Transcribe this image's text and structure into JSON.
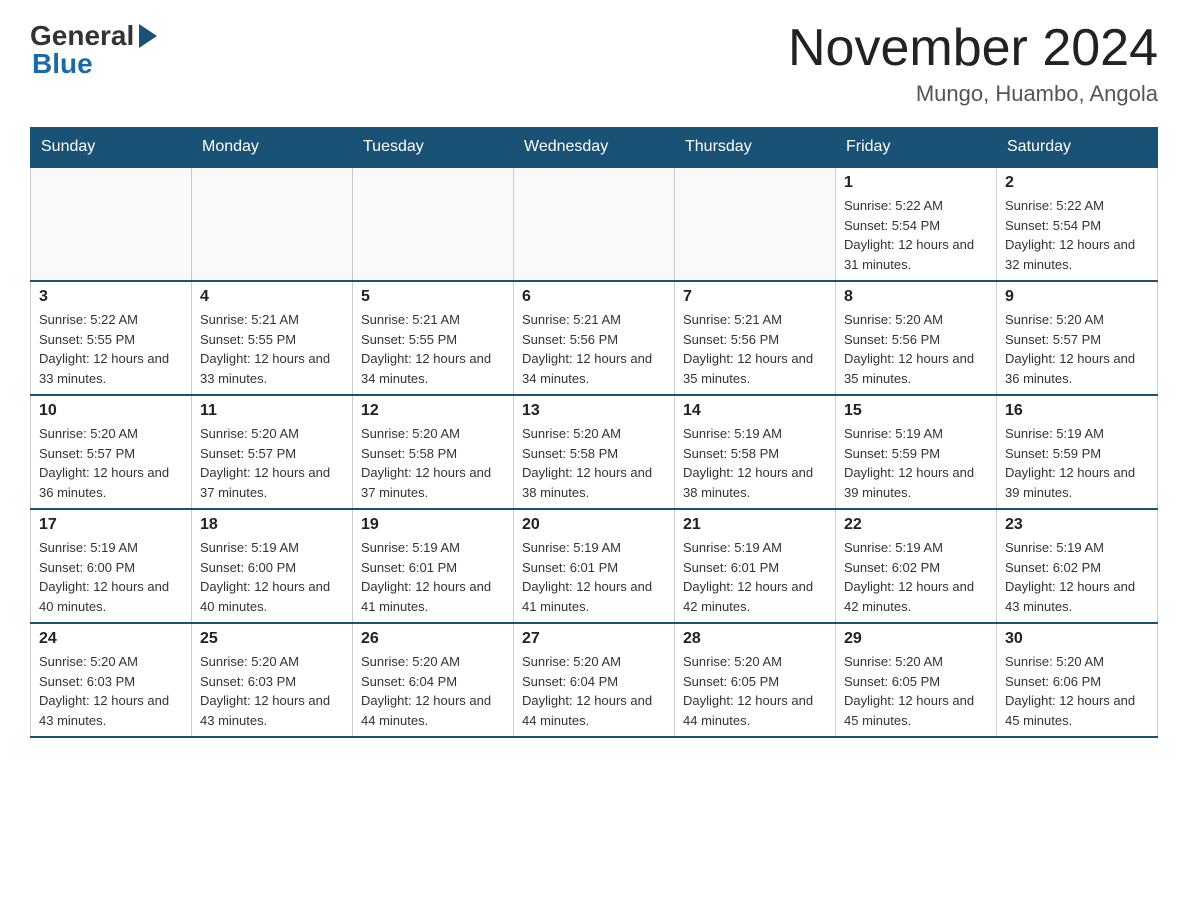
{
  "header": {
    "logo_general": "General",
    "logo_blue": "Blue",
    "month_title": "November 2024",
    "location": "Mungo, Huambo, Angola"
  },
  "days_of_week": [
    "Sunday",
    "Monday",
    "Tuesday",
    "Wednesday",
    "Thursday",
    "Friday",
    "Saturday"
  ],
  "weeks": [
    [
      {
        "day": "",
        "sunrise": "",
        "sunset": "",
        "daylight": ""
      },
      {
        "day": "",
        "sunrise": "",
        "sunset": "",
        "daylight": ""
      },
      {
        "day": "",
        "sunrise": "",
        "sunset": "",
        "daylight": ""
      },
      {
        "day": "",
        "sunrise": "",
        "sunset": "",
        "daylight": ""
      },
      {
        "day": "",
        "sunrise": "",
        "sunset": "",
        "daylight": ""
      },
      {
        "day": "1",
        "sunrise": "Sunrise: 5:22 AM",
        "sunset": "Sunset: 5:54 PM",
        "daylight": "Daylight: 12 hours and 31 minutes."
      },
      {
        "day": "2",
        "sunrise": "Sunrise: 5:22 AM",
        "sunset": "Sunset: 5:54 PM",
        "daylight": "Daylight: 12 hours and 32 minutes."
      }
    ],
    [
      {
        "day": "3",
        "sunrise": "Sunrise: 5:22 AM",
        "sunset": "Sunset: 5:55 PM",
        "daylight": "Daylight: 12 hours and 33 minutes."
      },
      {
        "day": "4",
        "sunrise": "Sunrise: 5:21 AM",
        "sunset": "Sunset: 5:55 PM",
        "daylight": "Daylight: 12 hours and 33 minutes."
      },
      {
        "day": "5",
        "sunrise": "Sunrise: 5:21 AM",
        "sunset": "Sunset: 5:55 PM",
        "daylight": "Daylight: 12 hours and 34 minutes."
      },
      {
        "day": "6",
        "sunrise": "Sunrise: 5:21 AM",
        "sunset": "Sunset: 5:56 PM",
        "daylight": "Daylight: 12 hours and 34 minutes."
      },
      {
        "day": "7",
        "sunrise": "Sunrise: 5:21 AM",
        "sunset": "Sunset: 5:56 PM",
        "daylight": "Daylight: 12 hours and 35 minutes."
      },
      {
        "day": "8",
        "sunrise": "Sunrise: 5:20 AM",
        "sunset": "Sunset: 5:56 PM",
        "daylight": "Daylight: 12 hours and 35 minutes."
      },
      {
        "day": "9",
        "sunrise": "Sunrise: 5:20 AM",
        "sunset": "Sunset: 5:57 PM",
        "daylight": "Daylight: 12 hours and 36 minutes."
      }
    ],
    [
      {
        "day": "10",
        "sunrise": "Sunrise: 5:20 AM",
        "sunset": "Sunset: 5:57 PM",
        "daylight": "Daylight: 12 hours and 36 minutes."
      },
      {
        "day": "11",
        "sunrise": "Sunrise: 5:20 AM",
        "sunset": "Sunset: 5:57 PM",
        "daylight": "Daylight: 12 hours and 37 minutes."
      },
      {
        "day": "12",
        "sunrise": "Sunrise: 5:20 AM",
        "sunset": "Sunset: 5:58 PM",
        "daylight": "Daylight: 12 hours and 37 minutes."
      },
      {
        "day": "13",
        "sunrise": "Sunrise: 5:20 AM",
        "sunset": "Sunset: 5:58 PM",
        "daylight": "Daylight: 12 hours and 38 minutes."
      },
      {
        "day": "14",
        "sunrise": "Sunrise: 5:19 AM",
        "sunset": "Sunset: 5:58 PM",
        "daylight": "Daylight: 12 hours and 38 minutes."
      },
      {
        "day": "15",
        "sunrise": "Sunrise: 5:19 AM",
        "sunset": "Sunset: 5:59 PM",
        "daylight": "Daylight: 12 hours and 39 minutes."
      },
      {
        "day": "16",
        "sunrise": "Sunrise: 5:19 AM",
        "sunset": "Sunset: 5:59 PM",
        "daylight": "Daylight: 12 hours and 39 minutes."
      }
    ],
    [
      {
        "day": "17",
        "sunrise": "Sunrise: 5:19 AM",
        "sunset": "Sunset: 6:00 PM",
        "daylight": "Daylight: 12 hours and 40 minutes."
      },
      {
        "day": "18",
        "sunrise": "Sunrise: 5:19 AM",
        "sunset": "Sunset: 6:00 PM",
        "daylight": "Daylight: 12 hours and 40 minutes."
      },
      {
        "day": "19",
        "sunrise": "Sunrise: 5:19 AM",
        "sunset": "Sunset: 6:01 PM",
        "daylight": "Daylight: 12 hours and 41 minutes."
      },
      {
        "day": "20",
        "sunrise": "Sunrise: 5:19 AM",
        "sunset": "Sunset: 6:01 PM",
        "daylight": "Daylight: 12 hours and 41 minutes."
      },
      {
        "day": "21",
        "sunrise": "Sunrise: 5:19 AM",
        "sunset": "Sunset: 6:01 PM",
        "daylight": "Daylight: 12 hours and 42 minutes."
      },
      {
        "day": "22",
        "sunrise": "Sunrise: 5:19 AM",
        "sunset": "Sunset: 6:02 PM",
        "daylight": "Daylight: 12 hours and 42 minutes."
      },
      {
        "day": "23",
        "sunrise": "Sunrise: 5:19 AM",
        "sunset": "Sunset: 6:02 PM",
        "daylight": "Daylight: 12 hours and 43 minutes."
      }
    ],
    [
      {
        "day": "24",
        "sunrise": "Sunrise: 5:20 AM",
        "sunset": "Sunset: 6:03 PM",
        "daylight": "Daylight: 12 hours and 43 minutes."
      },
      {
        "day": "25",
        "sunrise": "Sunrise: 5:20 AM",
        "sunset": "Sunset: 6:03 PM",
        "daylight": "Daylight: 12 hours and 43 minutes."
      },
      {
        "day": "26",
        "sunrise": "Sunrise: 5:20 AM",
        "sunset": "Sunset: 6:04 PM",
        "daylight": "Daylight: 12 hours and 44 minutes."
      },
      {
        "day": "27",
        "sunrise": "Sunrise: 5:20 AM",
        "sunset": "Sunset: 6:04 PM",
        "daylight": "Daylight: 12 hours and 44 minutes."
      },
      {
        "day": "28",
        "sunrise": "Sunrise: 5:20 AM",
        "sunset": "Sunset: 6:05 PM",
        "daylight": "Daylight: 12 hours and 44 minutes."
      },
      {
        "day": "29",
        "sunrise": "Sunrise: 5:20 AM",
        "sunset": "Sunset: 6:05 PM",
        "daylight": "Daylight: 12 hours and 45 minutes."
      },
      {
        "day": "30",
        "sunrise": "Sunrise: 5:20 AM",
        "sunset": "Sunset: 6:06 PM",
        "daylight": "Daylight: 12 hours and 45 minutes."
      }
    ]
  ]
}
